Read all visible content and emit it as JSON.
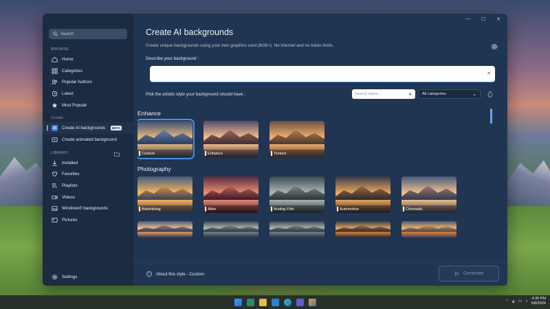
{
  "window": {
    "controls": [
      "—",
      "☐",
      "✕"
    ]
  },
  "sidebar": {
    "search_placeholder": "Search",
    "browse_label": "BROWSE",
    "browse_items": [
      {
        "label": "Home",
        "icon": "home-icon"
      },
      {
        "label": "Categories",
        "icon": "categories-icon"
      },
      {
        "label": "Popular Authors",
        "icon": "authors-icon"
      },
      {
        "label": "Latest",
        "icon": "clock-icon"
      },
      {
        "label": "Most Popular",
        "icon": "star-icon"
      }
    ],
    "create_label": "Create",
    "create_items": [
      {
        "label": "Create AI backgrounds",
        "badge": "BETA",
        "icon": "ai-icon"
      },
      {
        "label": "Create animated background",
        "icon": "animated-icon"
      }
    ],
    "library_label": "LIBRARY",
    "library_items": [
      {
        "label": "Installed",
        "icon": "download-icon"
      },
      {
        "label": "Favorites",
        "icon": "heart-icon"
      },
      {
        "label": "Playlists",
        "icon": "playlist-icon"
      },
      {
        "label": "Videos",
        "icon": "video-icon"
      },
      {
        "label": "Windows® backgrounds",
        "icon": "image-icon"
      },
      {
        "label": "Pictures",
        "icon": "picture-icon"
      }
    ],
    "settings_label": "Settings"
  },
  "main": {
    "title": "Create AI backgrounds",
    "subtitle": "Create unique backgrounds using your own graphics card (8GB+). No internet and no token limits.",
    "describe_label": "Describe your background :",
    "describe_value": "",
    "pick_label": "Pick the artistic style your background should have :",
    "style_search_placeholder": "Search styles...",
    "category_selected": "All categories",
    "groups": [
      {
        "title": "Enhance",
        "tiles": [
          {
            "label": "Custom",
            "selected": true,
            "palette": "custom"
          },
          {
            "label": "Enhance",
            "selected": false,
            "palette": "enhance"
          },
          {
            "label": "Texture",
            "selected": false,
            "palette": "texture"
          }
        ]
      },
      {
        "title": "Photography",
        "tiles": [
          {
            "label": "Advertising",
            "palette": "advertising"
          },
          {
            "label": "Alien",
            "palette": "alien"
          },
          {
            "label": "Analog Film",
            "palette": "analog"
          },
          {
            "label": "Automotive",
            "palette": "automotive"
          },
          {
            "label": "Cinematic",
            "palette": "cinematic"
          }
        ]
      }
    ],
    "about_text": "About this style - Custom",
    "generate_label": "Generate"
  },
  "taskbar": {
    "time": "4:30 PM",
    "date": "5/8/2026"
  },
  "colors": {
    "accent": "#4a8fe8",
    "sidebar_bg": "#1a2b42",
    "main_bg": "#1f3552"
  }
}
